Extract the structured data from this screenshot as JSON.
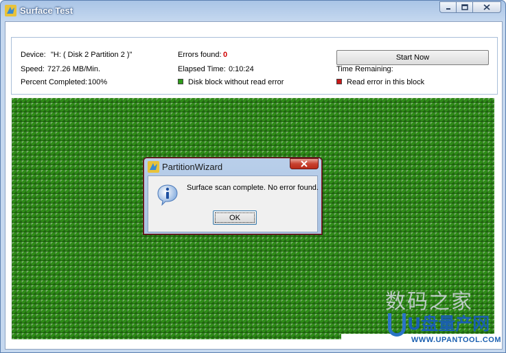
{
  "window": {
    "title": "Surface Test",
    "controls": {
      "minimize": "minimize-icon",
      "maximize": "maximize-icon",
      "close": "close-icon"
    }
  },
  "info": {
    "device_label": "Device:",
    "device_value": "\"H: ( Disk 2 Partition 2 )\"",
    "speed_label": "Speed:",
    "speed_value": "727.26 MB/Min.",
    "percent_label": "Percent Completed:",
    "percent_value": "100%",
    "errors_label": "Errors found:",
    "errors_value": "0",
    "elapsed_label": "Elapsed Time:",
    "elapsed_value": "0:10:24",
    "remaining_label": "Time Remaining:",
    "legend_ok": "Disk block without read error",
    "legend_err": "Read error in this block",
    "legend_ok_color": "#2e9b1a",
    "legend_err_color": "#c81818",
    "start_button": "Start Now"
  },
  "grid": {
    "block_color": "#2e8b17"
  },
  "dialog": {
    "title": "PartitionWizard",
    "message": "Surface scan complete. No error found.",
    "ok_label": "OK",
    "icon": "info-icon"
  },
  "watermark": {
    "line1": "数码之家",
    "line2": "U盘量产网",
    "url": "WWW.UPANTOOL.COM"
  }
}
